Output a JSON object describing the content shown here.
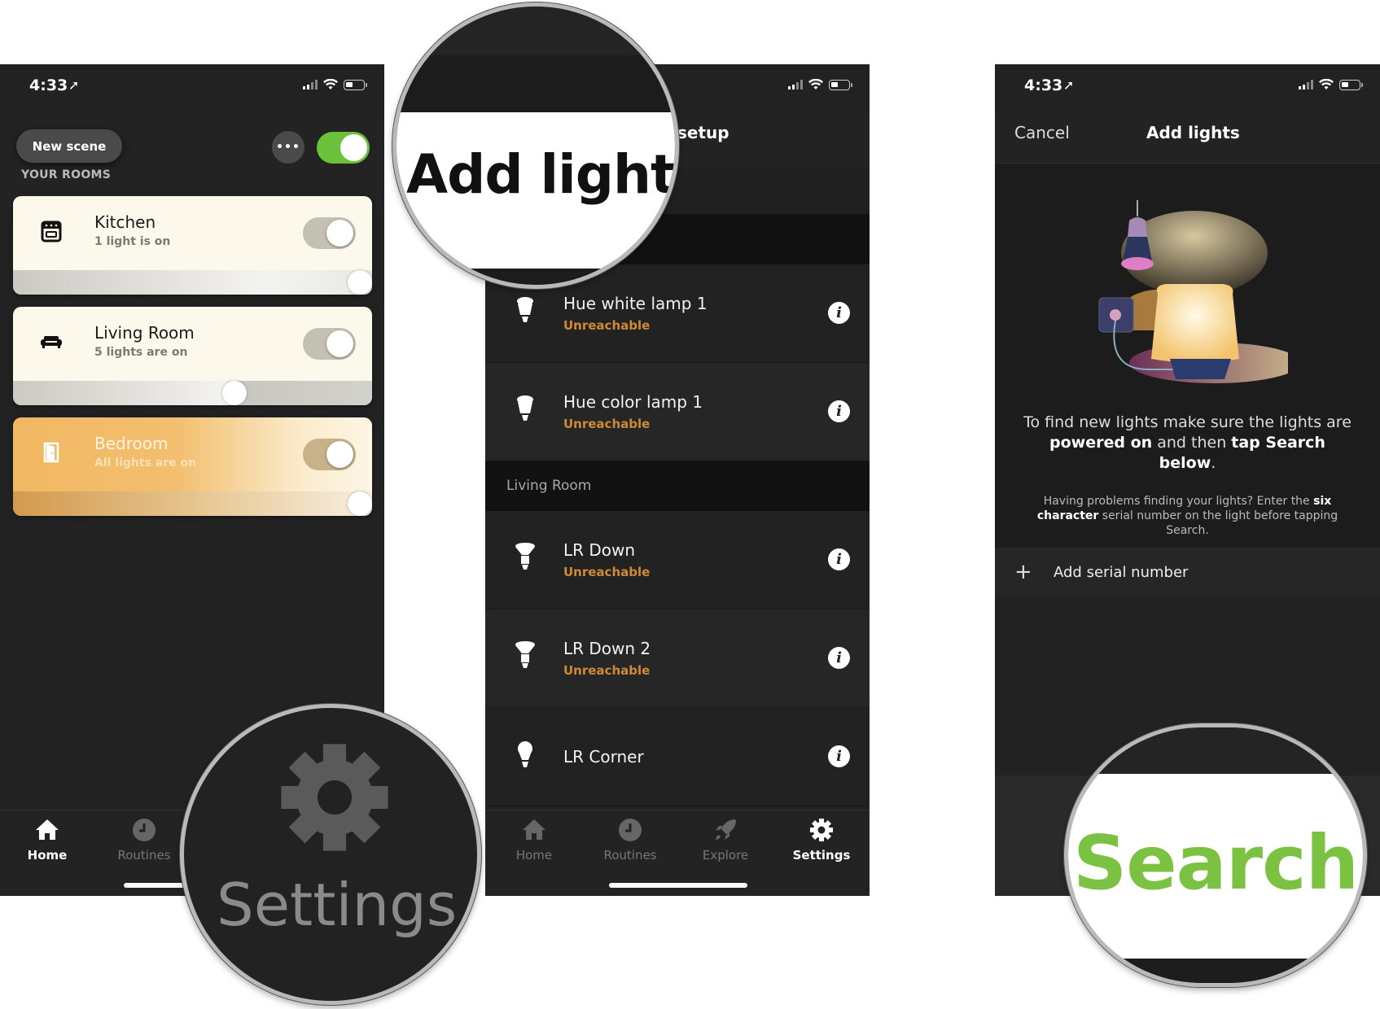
{
  "status_bar": {
    "time": "4:33"
  },
  "home": {
    "new_scene_label": "New scene",
    "more_label": "•••",
    "master_toggle_on": true,
    "section_label": "YOUR ROOMS",
    "rooms": [
      {
        "name": "Kitchen",
        "status": "1 light is on",
        "on": true,
        "brightness_pct": 100,
        "icon": "oven-icon"
      },
      {
        "name": "Living Room",
        "status": "5 lights are on",
        "on": true,
        "brightness_pct": 62,
        "icon": "sofa-icon"
      },
      {
        "name": "Bedroom",
        "status": "All lights are on",
        "on": true,
        "brightness_pct": 100,
        "icon": "door-icon"
      }
    ],
    "tabs": [
      {
        "label": "Home",
        "icon": "home-icon",
        "active": true
      },
      {
        "label": "Routines",
        "icon": "clock-icon",
        "active": false
      }
    ]
  },
  "setup": {
    "title_partial": "setup",
    "sections": [
      {
        "name": "",
        "lights": [
          {
            "name": "Hue white lamp 1",
            "status": "Unreachable",
            "icon": "bulb-icon"
          },
          {
            "name": "Hue color lamp 1",
            "status": "Unreachable",
            "icon": "bulb-icon"
          }
        ]
      },
      {
        "name": "Living Room",
        "lights": [
          {
            "name": "LR Down",
            "status": "Unreachable",
            "icon": "spot-bulb-icon"
          },
          {
            "name": "LR Down 2",
            "status": "Unreachable",
            "icon": "spot-bulb-icon"
          },
          {
            "name": "LR Corner",
            "status": "",
            "icon": "bulb-icon"
          }
        ]
      }
    ],
    "tabs": [
      {
        "label": "Home",
        "icon": "home-icon",
        "active": false
      },
      {
        "label": "Routines",
        "icon": "clock-icon",
        "active": false
      },
      {
        "label": "Explore",
        "icon": "rocket-icon",
        "active": false
      },
      {
        "label": "Settings",
        "icon": "gear-icon",
        "active": true
      }
    ],
    "info_glyph": "i"
  },
  "add_lights": {
    "cancel_label": "Cancel",
    "title": "Add lights",
    "lead": {
      "t1": "To find new lights make sure the lights are ",
      "b1": "powered on",
      "t2": " and then ",
      "b2": "tap Search below",
      "t3": "."
    },
    "help": {
      "t1": "Having problems finding your lights? Enter the ",
      "b1": "six character",
      "t2": " serial number on the light before tapping Search."
    },
    "add_serial_label": "Add serial number",
    "plus": "+"
  },
  "callouts": {
    "add_light": "Add light",
    "settings": "Settings",
    "search": "Search"
  },
  "colors": {
    "accent_green": "#7cc242",
    "toggle_green": "#6cc13b",
    "unreachable": "#d08a36"
  }
}
